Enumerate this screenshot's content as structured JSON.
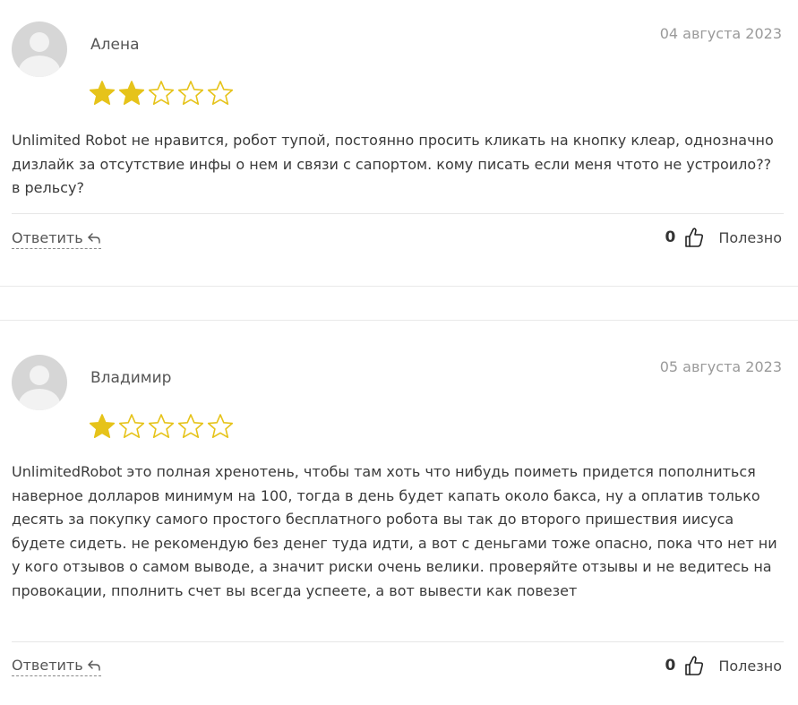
{
  "colors": {
    "star_filled": "#e6c31a",
    "star_empty_outline": "#e6c31a",
    "avatar_bg": "#d6d6d6"
  },
  "reviews": [
    {
      "author": "Алена",
      "date": "04 августа 2023",
      "rating": 2,
      "rating_max": 5,
      "text": "Unlimited Robot не нравится, робот тупой, постоянно просить кликать на кнопку клеар, однозначно дизлайк за отсутствие инфы о нем и связи с сапортом. кому писать если меня чтото не устроило?? в рельсу?",
      "reply_label": "Ответить",
      "useful_count": "0",
      "useful_label": "Полезно"
    },
    {
      "author": "Владимир",
      "date": "05 августа 2023",
      "rating": 1,
      "rating_max": 5,
      "text": "UnlimitedRobot это полная хренотень, чтобы там хоть что нибудь поиметь придется пополниться наверное долларов минимум на 100, тогда в день будет капать около бакса, ну а оплатив только десять за покупку самого простого бесплатного робота вы так до второго пришествия иисуса будете сидеть. не рекомендую без денег туда идти, а вот с деньгами тоже опасно, пока что нет ни у кого отзывов о самом выводе, а значит риски очень велики. проверяйте отзывы и не ведитесь на провокации, пполнить счет вы всегда успеете, а вот вывести как повезет",
      "reply_label": "Ответить",
      "useful_count": "0",
      "useful_label": "Полезно"
    }
  ],
  "icons": {
    "avatar": "user-avatar-placeholder",
    "star": "star-icon",
    "reply": "reply-arrow-icon",
    "useful": "thumbs-up-icon"
  }
}
